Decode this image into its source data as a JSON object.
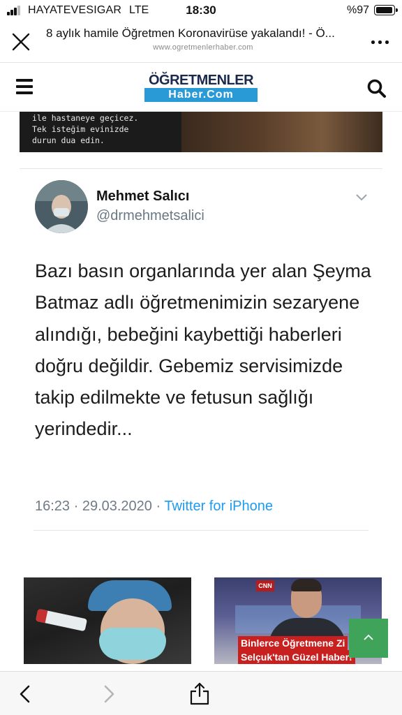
{
  "status_bar": {
    "carrier": "HAYATEVESIGAR",
    "network": "LTE",
    "time": "18:30",
    "battery_percent": "%97",
    "battery_level": 0.97
  },
  "browser": {
    "page_title": "8 aylık hamile Öğretmen Koronavirüse yakalandı! - Ö...",
    "url": "www.ogretmenlerhaber.com",
    "close_icon": "close-icon",
    "more_icon": "more-horizontal-icon"
  },
  "site_header": {
    "logo_top": "ÖĞRETMENLER",
    "logo_bottom": "Haber.Com",
    "menu_icon": "hamburger-icon",
    "search_icon": "search-icon"
  },
  "top_image": {
    "caption": "ile hastaneye geçicez.\nTek isteğim evinizde\ndurun dua edin."
  },
  "tweet": {
    "author_name": "Mehmet Salıcı",
    "author_handle": "@drmehmetsalici",
    "text": "Bazı basın organlarında yer alan Şeyma Batmaz adlı öğretmenimizin sezaryene alındığı, bebeğini kaybettiği haberleri doğru değildir. Gebemiz servisimizde takip edilmekte ve fetusun sağlığı yerindedir...",
    "time_date": "16:23 · 29.03.2020 · ",
    "source": "Twitter for iPhone"
  },
  "related": [
    {
      "image": "coronavirus-test-nurse"
    },
    {
      "image": "minister-tv-interview",
      "headline_line1": "Binlerce Öğretmene Zi",
      "headline_line2": "Selçuk'tan Güzel Haber!",
      "channel_logo": "CNN"
    }
  ],
  "bottom_toolbar": {
    "back_icon": "chevron-left-icon",
    "forward_icon": "chevron-right-icon",
    "share_icon": "share-icon"
  },
  "colors": {
    "logo_blue": "#2a9ad6",
    "logo_navy": "#1a2a4f",
    "twitter_blue": "#1d9bf0",
    "scroll_top_green": "#3fa35a",
    "headline_red": "#c81f1f"
  }
}
